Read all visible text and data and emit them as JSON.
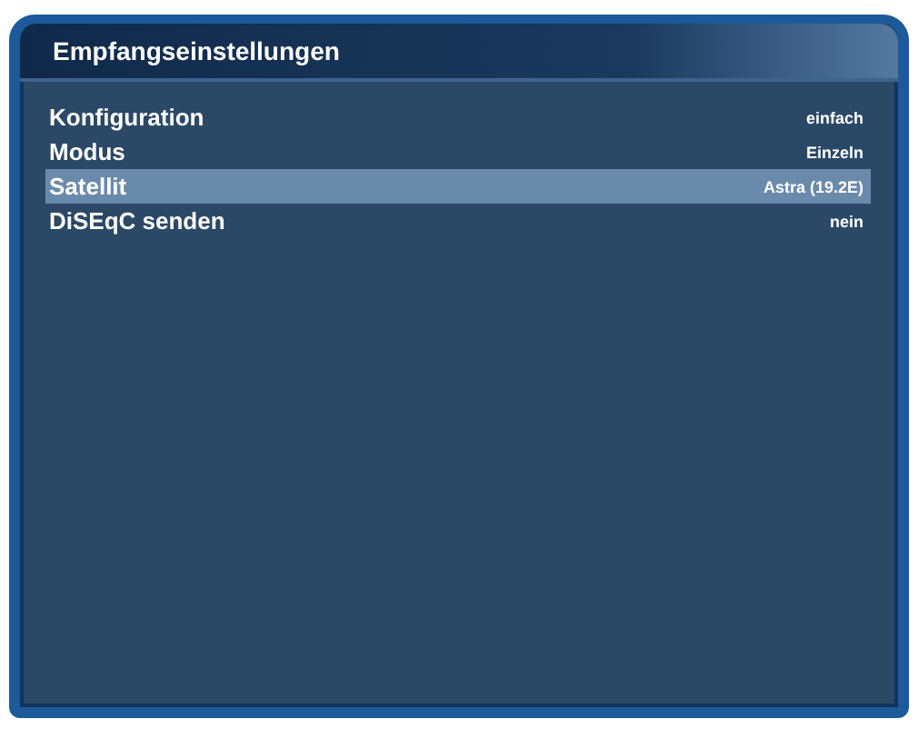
{
  "window": {
    "title": "Empfangseinstellungen"
  },
  "rows": [
    {
      "label": "Konfiguration",
      "value": "einfach",
      "selected": false
    },
    {
      "label": "Modus",
      "value": "Einzeln",
      "selected": false
    },
    {
      "label": "Satellit",
      "value": "Astra (19.2E)",
      "selected": true
    },
    {
      "label": "DiSEqC senden",
      "value": "nein",
      "selected": false
    }
  ]
}
